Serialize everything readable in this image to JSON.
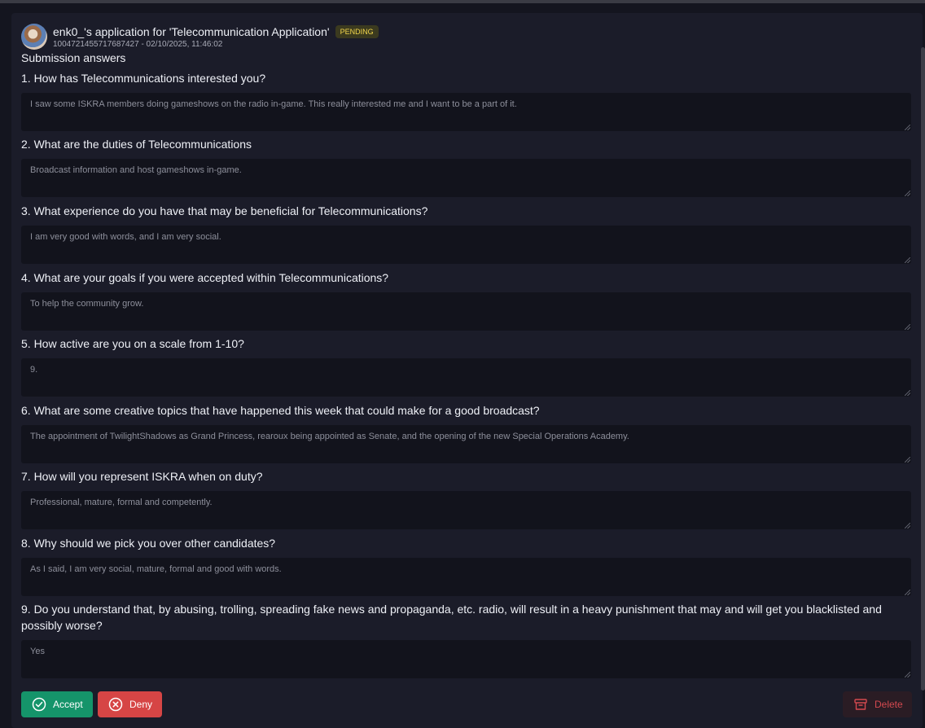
{
  "header": {
    "title": "enk0_'s application for 'Telecommunication Application'",
    "status_badge": "PENDING",
    "subtitle": "1004721455717687427 - 02/10/2025, 11:46:02"
  },
  "section_title": "Submission answers",
  "questions": [
    {
      "question": "1. How has Telecommunications interested you?",
      "answer": "I saw some ISKRA members doing gameshows on the radio in-game. This really interested me and I want to be a part of it."
    },
    {
      "question": "2. What are the duties of Telecommunications",
      "answer": "Broadcast information and host gameshows in-game."
    },
    {
      "question": "3. What experience do you have that may be beneficial for Telecommunications?",
      "answer": "I am very good with words, and I am very social."
    },
    {
      "question": "4. What are your goals if you were accepted within Telecommunications?",
      "answer": "To help the community grow."
    },
    {
      "question": "5. How active are you on a scale from 1-10?",
      "answer": "9."
    },
    {
      "question": "6. What are some creative topics that have happened this week that could make for a good broadcast?",
      "answer": "The appointment of TwilightShadows as Grand Princess, rearoux being appointed as Senate, and the opening of the new Special Operations Academy."
    },
    {
      "question": "7. How will you represent ISKRA when on duty?",
      "answer": "Professional, mature, formal and competently."
    },
    {
      "question": "8. Why should we pick you over other candidates?",
      "answer": "As I said, I am very social, mature, formal and good with words."
    },
    {
      "question": "9. Do you understand that, by abusing, trolling, spreading fake news and propaganda, etc. radio, will result in a heavy punishment that may and will get you blacklisted and possibly worse?",
      "answer": "Yes"
    }
  ],
  "actions": {
    "accept_label": "Accept",
    "deny_label": "Deny",
    "delete_label": "Delete"
  },
  "colors": {
    "accept": "#15946a",
    "deny": "#d64545",
    "delete_text": "#d3494f",
    "pending": "#f1d54b"
  },
  "icons": {
    "accept": "check-circle-icon",
    "deny": "x-circle-icon",
    "delete": "archive-icon"
  }
}
